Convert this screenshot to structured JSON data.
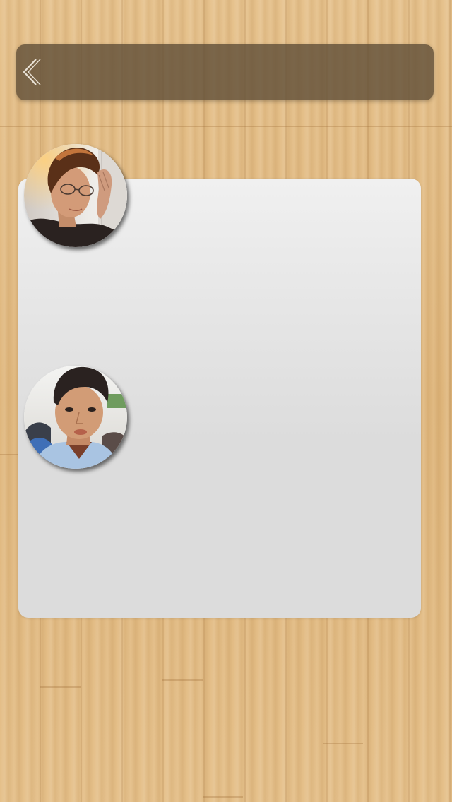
{
  "header": {
    "back_icon": "chevron-left-icon"
  },
  "participants": [
    {
      "avatar_icon": "user-photo",
      "accent": "#2b2220"
    },
    {
      "avatar_icon": "user-photo",
      "accent": "#b8cde3"
    }
  ],
  "colors": {
    "header_bg": "#5f4e37",
    "card_bg": "#dcdcdc",
    "wood": "#e3bd86"
  }
}
